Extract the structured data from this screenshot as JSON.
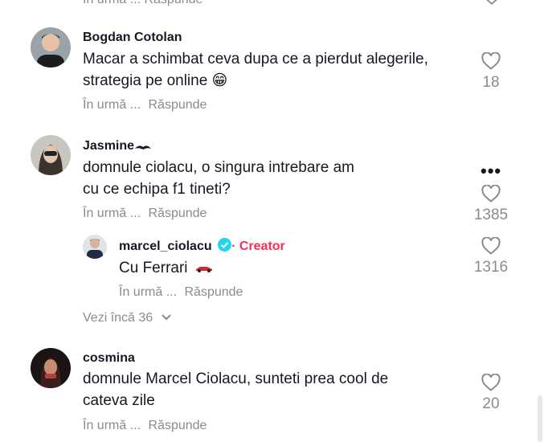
{
  "top_partial": {
    "reply_text": "În urmă ... Răspunde"
  },
  "comments": [
    {
      "username": "Bogdan Cotolan",
      "text_line1": "Macar a schimbat ceva dupa ce a pierdut alegerile,",
      "text_line2": "strategia pe online 😁",
      "time": "În urmă ...",
      "reply": "Răspunde",
      "likes": "18"
    },
    {
      "username": "Jasmine",
      "text_line1": "domnule ciolacu, o singura intrebare am",
      "text_line2": "cu ce echipa f1 tineti?",
      "time": "În urmă ...",
      "reply": "Răspunde",
      "likes": "1385",
      "more": "•••",
      "replies": [
        {
          "username": "marcel_ciolacu",
          "badge": "Creator",
          "separator": "·",
          "text": "Cu Ferrari",
          "time": "În urmă ...",
          "reply": "Răspunde",
          "likes": "1316"
        }
      ],
      "view_more": "Vezi încă 36"
    },
    {
      "username": "cosmina",
      "text_line1": "domnule Marcel Ciolacu, sunteti prea cool de",
      "text_line2": "cateva zile",
      "time": "În urmă ...",
      "reply": "Răspunde",
      "likes": "20"
    }
  ],
  "icons": {
    "like": "heart-outline-icon",
    "verified": "verified-check-icon",
    "car": "race-car-icon",
    "chevron": "chevron-down-icon"
  },
  "colors": {
    "creator": "#fe2c55",
    "verified": "#20d5ec",
    "meta": "#8a8b91"
  }
}
